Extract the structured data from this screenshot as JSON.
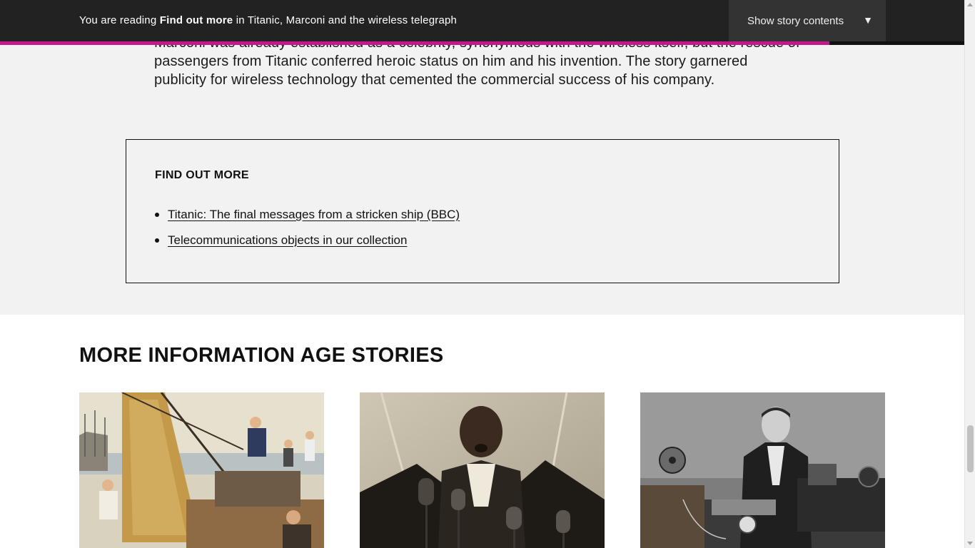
{
  "topbar": {
    "reading_prefix": "You are reading",
    "section_name": "Find out more",
    "reading_mid": "in",
    "story_title": "Titanic, Marconi and the wireless telegraph",
    "contents_label": "Show story contents",
    "contents_arrow": "▼",
    "progress_fraction": 0.86,
    "accent_color": "#c4178c"
  },
  "article": {
    "paragraph": "Marconi was already established as a celebrity, synonymous with the wireless itself, but the rescue of passengers from Titanic conferred heroic status on him and his invention. The story garnered publicity for wireless technology that cemented the commercial success of his company."
  },
  "find_out_more": {
    "heading": "FIND OUT MORE",
    "links": [
      {
        "label": "Titanic: The final messages from a stricken ship (BBC)"
      },
      {
        "label": "Telecommunications objects in our collection"
      }
    ]
  },
  "more_stories": {
    "heading": "MORE INFORMATION AGE STORIES",
    "cards": [
      {
        "image": "illustration-cable-laying-ship-deck"
      },
      {
        "image": "photo-singer-at-microphones"
      },
      {
        "image": "photo-marconi-with-wireless-apparatus"
      }
    ]
  },
  "scrollbar": {
    "position_fraction": 0.82
  }
}
